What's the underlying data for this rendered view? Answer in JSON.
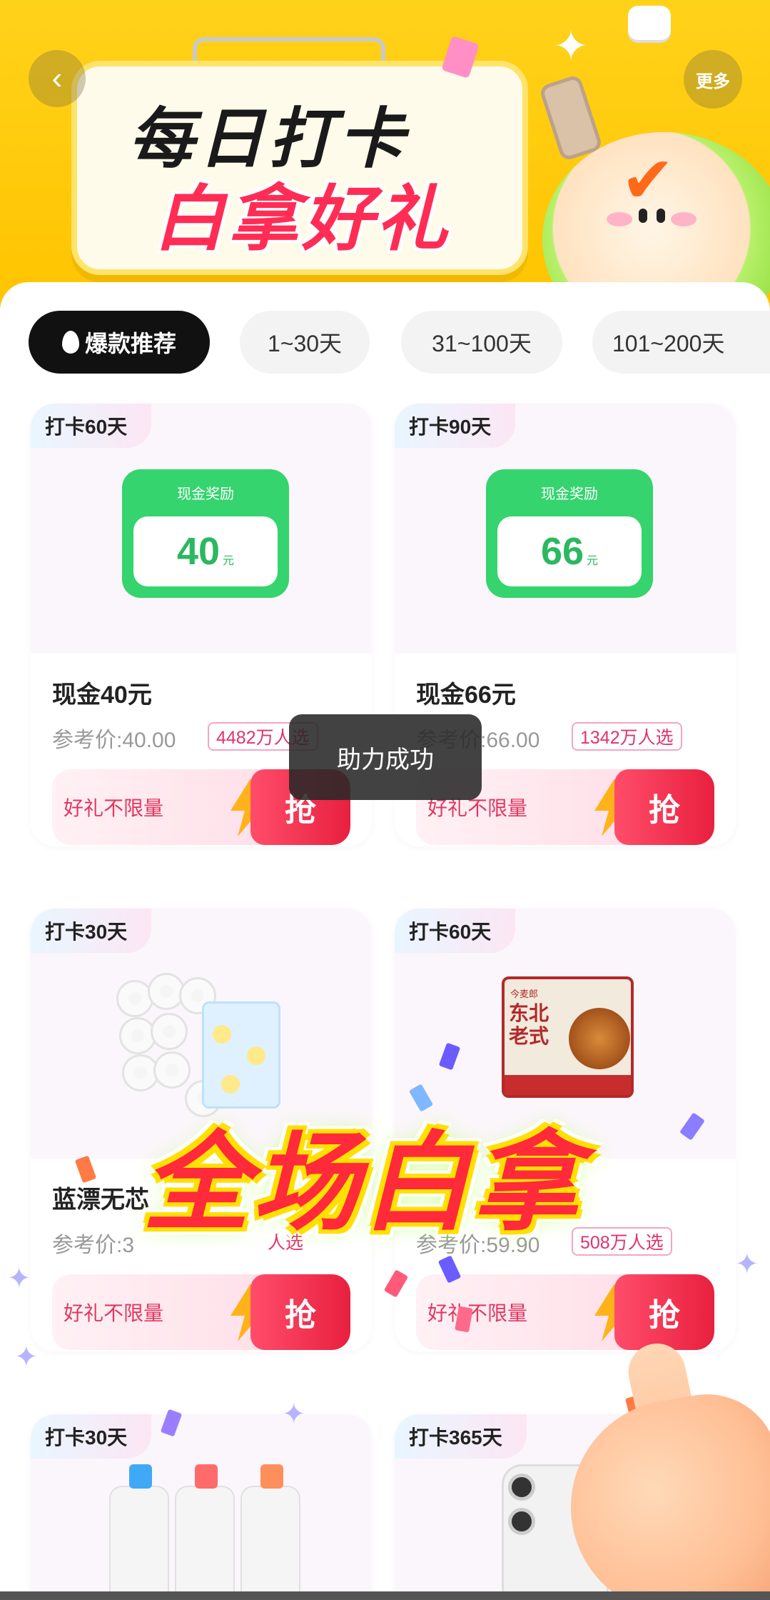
{
  "header": {
    "back_icon": "‹",
    "more_label": "更多",
    "banner_line1": "每日打卡",
    "banner_line2": "白拿好礼"
  },
  "tabs": [
    {
      "label": "爆款推荐",
      "active": true
    },
    {
      "label": "1~30天",
      "active": false
    },
    {
      "label": "31~100天",
      "active": false
    },
    {
      "label": "101~200天",
      "active": false
    }
  ],
  "cards": [
    {
      "days": "打卡60天",
      "cash_title": "现金奖励",
      "cash_amount": "40",
      "cash_unit": "元",
      "name": "现金40元",
      "price": "参考价:40.00",
      "count": "4482万人选",
      "grab_label": "好礼不限量",
      "grab_button": "抢"
    },
    {
      "days": "打卡90天",
      "cash_title": "现金奖励",
      "cash_amount": "66",
      "cash_unit": "元",
      "name": "现金66元",
      "price": "参考价:66.00",
      "count": "1342万人选",
      "grab_label": "好礼不限量",
      "grab_button": "抢"
    },
    {
      "days": "打卡30天",
      "name": "蓝漂无芯",
      "price": "参考价:3",
      "count": "人选",
      "grab_label": "好礼不限量",
      "grab_button": "抢"
    },
    {
      "days": "打卡60天",
      "name": "",
      "price": "参考价:59.90",
      "count": "508万人选",
      "grab_label": "好礼不限量",
      "grab_button": "抢",
      "product_brand": "今麦郎",
      "product_big": "东北老式"
    },
    {
      "days": "打卡30天"
    },
    {
      "days": "打卡365天"
    }
  ],
  "toast": "助力成功",
  "promo": "全场白拿",
  "colors": {
    "banner_yellow": "#ffd21a",
    "accent_red": "#ff2d55",
    "cash_green": "#35d46e",
    "grab_red": "#e8203e"
  }
}
